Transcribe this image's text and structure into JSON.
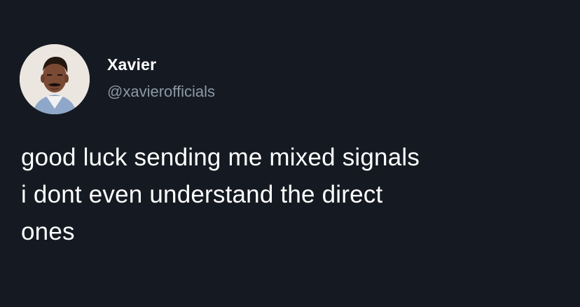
{
  "tweet": {
    "author": {
      "display_name": "Xavier",
      "handle": "@xavierofficials",
      "avatar_icon": "profile-photo"
    },
    "text_lines": [
      "good luck sending me mixed signals",
      "i dont even understand the direct",
      "ones"
    ]
  },
  "colors": {
    "background": "#151a22",
    "primary_text": "#ffffff",
    "secondary_text": "#8b98a5"
  }
}
